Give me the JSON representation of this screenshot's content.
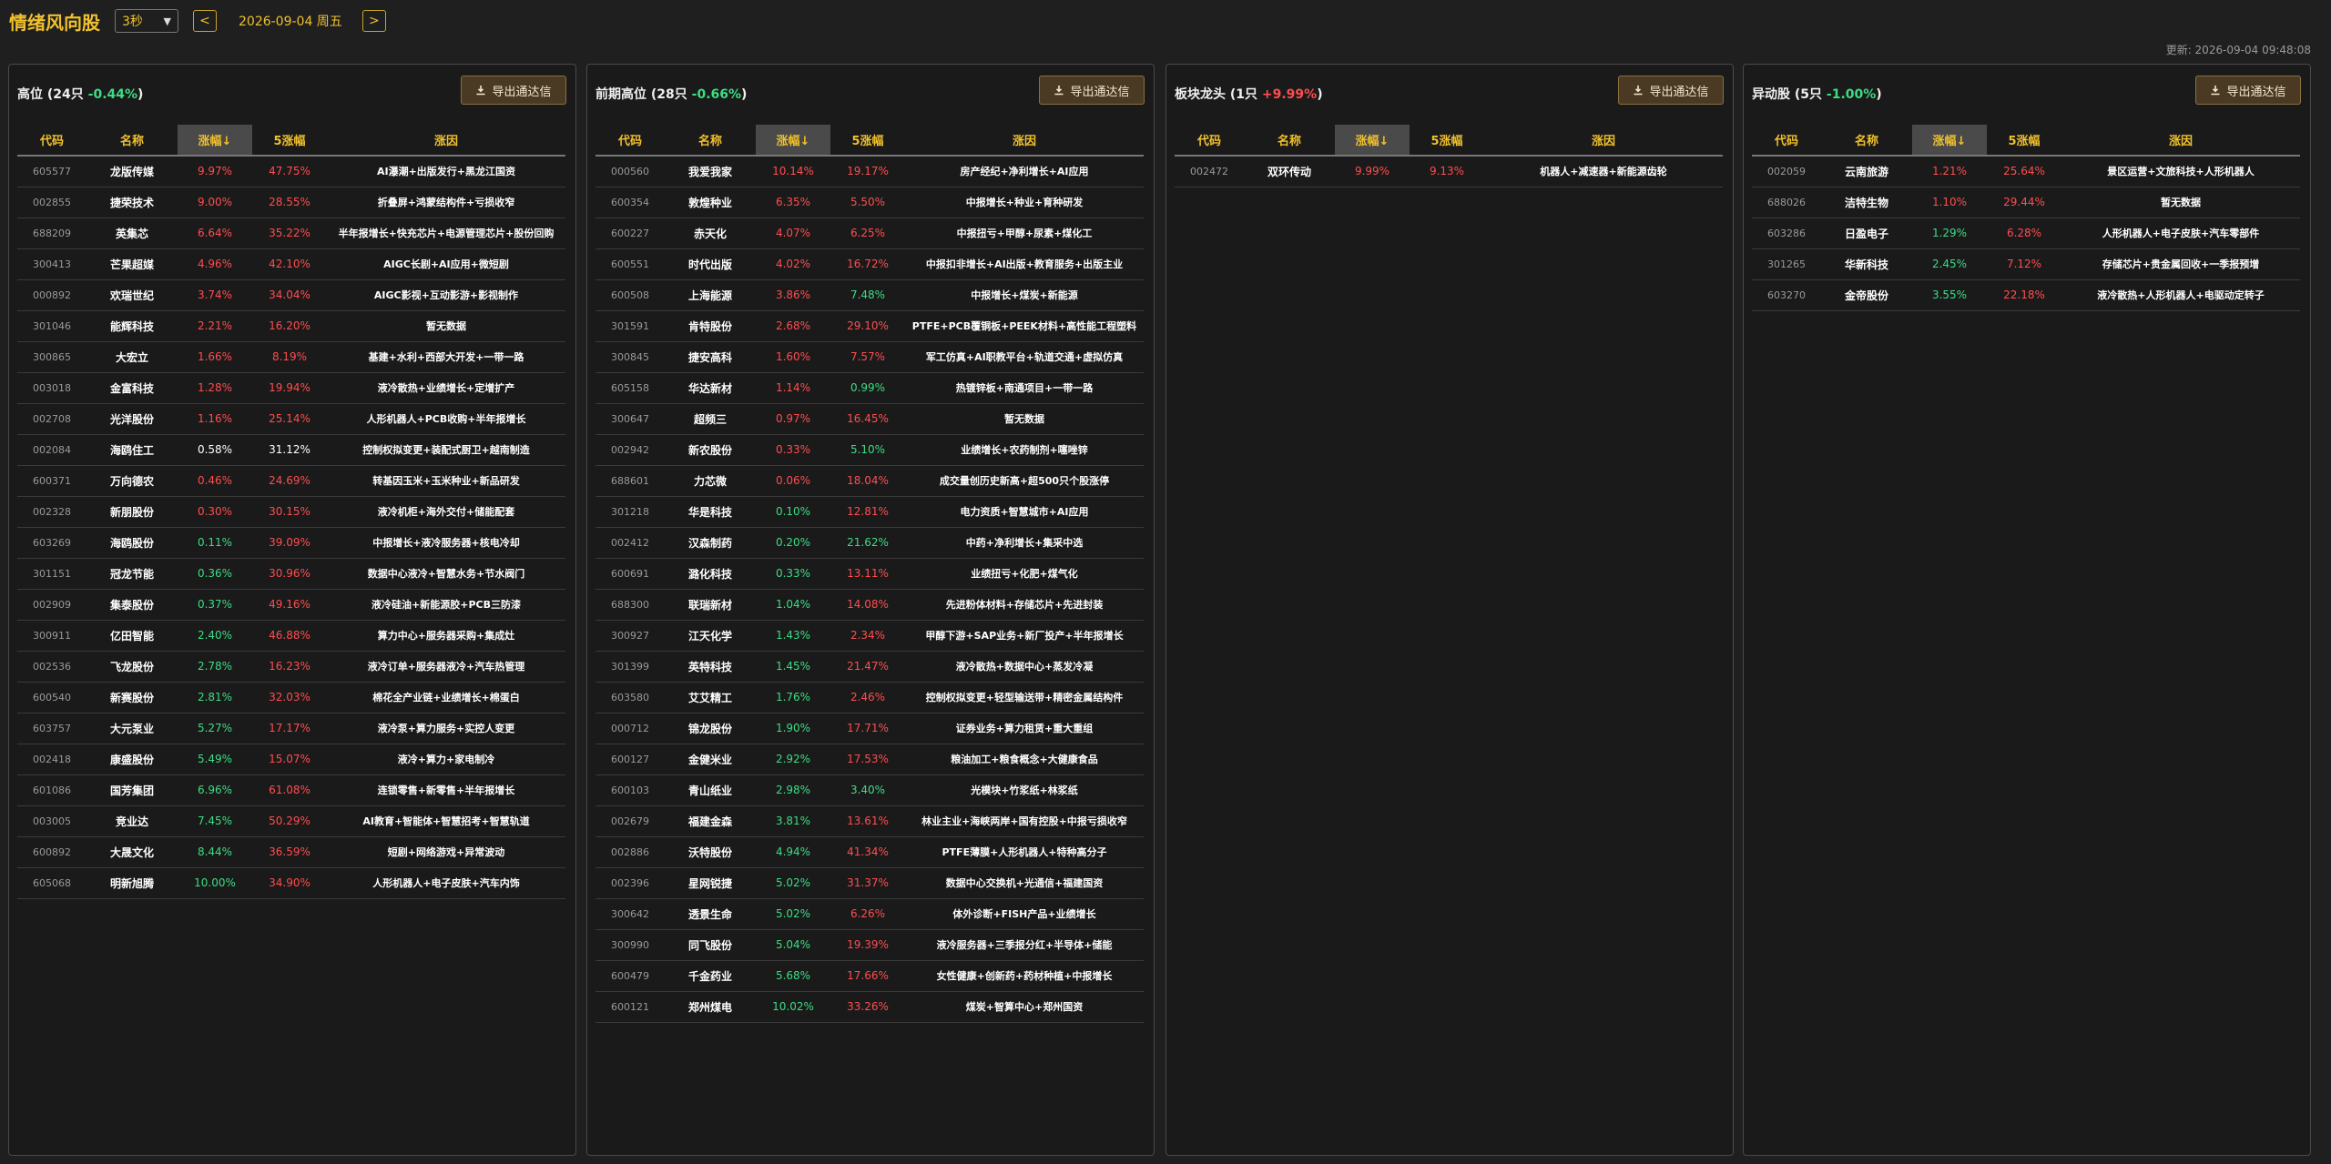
{
  "header": {
    "title": "情绪风向股",
    "refresh": "3秒",
    "prev": "<",
    "date": "2026-09-04 周五",
    "next": ">",
    "update": "更新: 2026-09-04 09:48:08"
  },
  "export_label": "导出通达信",
  "columns": [
    "代码",
    "名称",
    "涨幅↓",
    "5涨幅",
    "涨因"
  ],
  "colors": {
    "up": "#ff4d4f",
    "down": "#3ddc84",
    "accent": "#f0c02c"
  },
  "panels": [
    {
      "title": "高位 (24只",
      "change": "-0.44%",
      "change_color": "green",
      "rows": [
        [
          "605577",
          "龙版传媒",
          "9.97%",
          "47.75%",
          "AI瀑潮+出版发行+黑龙江国资",
          "red",
          "red"
        ],
        [
          "002855",
          "捷荣技术",
          "9.00%",
          "28.55%",
          "折叠屏+鸿蒙结构件+亏损收窄",
          "red",
          "red"
        ],
        [
          "688209",
          "英集芯",
          "6.64%",
          "35.22%",
          "半年报增长+快充芯片+电源管理芯片+股份回购",
          "red",
          "red"
        ],
        [
          "300413",
          "芒果超媒",
          "4.96%",
          "42.10%",
          "AIGC长剧+AI应用+微短剧",
          "red",
          "red"
        ],
        [
          "000892",
          "欢瑞世纪",
          "3.74%",
          "34.04%",
          "AIGC影视+互动影游+影视制作",
          "red",
          "red"
        ],
        [
          "301046",
          "能辉科技",
          "2.21%",
          "16.20%",
          "暂无数据",
          "red",
          "red"
        ],
        [
          "300865",
          "大宏立",
          "1.66%",
          "8.19%",
          "基建+水利+西部大开发+一带一路",
          "red",
          "red"
        ],
        [
          "003018",
          "金富科技",
          "1.28%",
          "19.94%",
          "液冷散热+业绩增长+定增扩产",
          "red",
          "red"
        ],
        [
          "002708",
          "光洋股份",
          "1.16%",
          "25.14%",
          "人形机器人+PCB收购+半年报增长",
          "red",
          "red"
        ],
        [
          "002084",
          "海鸥住工",
          "0.58%",
          "31.12%",
          "控制权拟变更+装配式厨卫+越南制造",
          "white",
          "white"
        ],
        [
          "600371",
          "万向德农",
          "0.46%",
          "24.69%",
          "转基因玉米+玉米种业+新品研发",
          "red",
          "red"
        ],
        [
          "002328",
          "新朋股份",
          "0.30%",
          "30.15%",
          "液冷机柜+海外交付+储能配套",
          "red",
          "red"
        ],
        [
          "603269",
          "海鸥股份",
          "0.11%",
          "39.09%",
          "中报增长+液冷服务器+核电冷却",
          "green",
          "red"
        ],
        [
          "301151",
          "冠龙节能",
          "0.36%",
          "30.96%",
          "数据中心液冷+智慧水务+节水阀门",
          "green",
          "red"
        ],
        [
          "002909",
          "集泰股份",
          "0.37%",
          "49.16%",
          "液冷硅油+新能源胶+PCB三防漆",
          "green",
          "red"
        ],
        [
          "300911",
          "亿田智能",
          "2.40%",
          "46.88%",
          "算力中心+服务器采购+集成灶",
          "green",
          "red"
        ],
        [
          "002536",
          "飞龙股份",
          "2.78%",
          "16.23%",
          "液冷订单+服务器液冷+汽车热管理",
          "green",
          "red"
        ],
        [
          "600540",
          "新赛股份",
          "2.81%",
          "32.03%",
          "棉花全产业链+业绩增长+棉蛋白",
          "green",
          "red"
        ],
        [
          "603757",
          "大元泵业",
          "5.27%",
          "17.17%",
          "液冷泵+算力服务+实控人变更",
          "green",
          "red"
        ],
        [
          "002418",
          "康盛股份",
          "5.49%",
          "15.07%",
          "液冷+算力+家电制冷",
          "green",
          "red"
        ],
        [
          "601086",
          "国芳集团",
          "6.96%",
          "61.08%",
          "连锁零售+新零售+半年报增长",
          "green",
          "red"
        ],
        [
          "003005",
          "竞业达",
          "7.45%",
          "50.29%",
          "AI教育+智能体+智慧招考+智慧轨道",
          "green",
          "red"
        ],
        [
          "600892",
          "大晟文化",
          "8.44%",
          "36.59%",
          "短剧+网络游戏+异常波动",
          "green",
          "red"
        ],
        [
          "605068",
          "明新旭腾",
          "10.00%",
          "34.90%",
          "人形机器人+电子皮肤+汽车内饰",
          "green",
          "red"
        ]
      ]
    },
    {
      "title": "前期高位 (28只",
      "change": "-0.66%",
      "change_color": "green",
      "rows": [
        [
          "000560",
          "我爱我家",
          "10.14%",
          "19.17%",
          "房产经纪+净利增长+AI应用",
          "red",
          "red"
        ],
        [
          "600354",
          "敦煌种业",
          "6.35%",
          "5.50%",
          "中报增长+种业+育种研发",
          "red",
          "red"
        ],
        [
          "600227",
          "赤天化",
          "4.07%",
          "6.25%",
          "中报扭亏+甲醇+尿素+煤化工",
          "red",
          "red"
        ],
        [
          "600551",
          "时代出版",
          "4.02%",
          "16.72%",
          "中报扣非增长+AI出版+教育服务+出版主业",
          "red",
          "red"
        ],
        [
          "600508",
          "上海能源",
          "3.86%",
          "7.48%",
          "中报增长+煤炭+新能源",
          "red",
          "green"
        ],
        [
          "301591",
          "肯特股份",
          "2.68%",
          "29.10%",
          "PTFE+PCB覆铜板+PEEK材料+高性能工程塑料",
          "red",
          "red"
        ],
        [
          "300845",
          "捷安高科",
          "1.60%",
          "7.57%",
          "军工仿真+AI职教平台+轨道交通+虚拟仿真",
          "red",
          "red"
        ],
        [
          "605158",
          "华达新材",
          "1.14%",
          "0.99%",
          "热镀锌板+南通项目+一带一路",
          "red",
          "green"
        ],
        [
          "300647",
          "超频三",
          "0.97%",
          "16.45%",
          "暂无数据",
          "red",
          "red"
        ],
        [
          "002942",
          "新农股份",
          "0.33%",
          "5.10%",
          "业绩增长+农药制剂+噻唑锌",
          "red",
          "green"
        ],
        [
          "688601",
          "力芯微",
          "0.06%",
          "18.04%",
          "成交量创历史新高+超500只个股涨停",
          "red",
          "red"
        ],
        [
          "301218",
          "华是科技",
          "0.10%",
          "12.81%",
          "电力资质+智慧城市+AI应用",
          "green",
          "red"
        ],
        [
          "002412",
          "汉森制药",
          "0.20%",
          "21.62%",
          "中药+净利增长+集采中选",
          "green",
          "green"
        ],
        [
          "600691",
          "潞化科技",
          "0.33%",
          "13.11%",
          "业绩扭亏+化肥+煤气化",
          "green",
          "red"
        ],
        [
          "688300",
          "联瑞新材",
          "1.04%",
          "14.08%",
          "先进粉体材料+存储芯片+先进封装",
          "green",
          "red"
        ],
        [
          "300927",
          "江天化学",
          "1.43%",
          "2.34%",
          "甲醇下游+SAP业务+新厂投产+半年报增长",
          "green",
          "red"
        ],
        [
          "301399",
          "英特科技",
          "1.45%",
          "21.47%",
          "液冷散热+数据中心+蒸发冷凝",
          "green",
          "red"
        ],
        [
          "603580",
          "艾艾精工",
          "1.76%",
          "2.46%",
          "控制权拟变更+轻型输送带+精密金属结构件",
          "green",
          "red"
        ],
        [
          "000712",
          "锦龙股份",
          "1.90%",
          "17.71%",
          "证券业务+算力租赁+重大重组",
          "green",
          "red"
        ],
        [
          "600127",
          "金健米业",
          "2.92%",
          "17.53%",
          "粮油加工+粮食概念+大健康食品",
          "green",
          "red"
        ],
        [
          "600103",
          "青山纸业",
          "2.98%",
          "3.40%",
          "光模块+竹浆纸+林浆纸",
          "green",
          "green"
        ],
        [
          "002679",
          "福建金森",
          "3.81%",
          "13.61%",
          "林业主业+海峡两岸+国有控股+中报亏损收窄",
          "green",
          "red"
        ],
        [
          "002886",
          "沃特股份",
          "4.94%",
          "41.34%",
          "PTFE薄膜+人形机器人+特种高分子",
          "green",
          "red"
        ],
        [
          "002396",
          "星网锐捷",
          "5.02%",
          "31.37%",
          "数据中心交换机+光通信+福建国资",
          "green",
          "red"
        ],
        [
          "300642",
          "透景生命",
          "5.02%",
          "6.26%",
          "体外诊断+FISH产品+业绩增长",
          "green",
          "red"
        ],
        [
          "300990",
          "同飞股份",
          "5.04%",
          "19.39%",
          "液冷服务器+三季报分红+半导体+储能",
          "green",
          "red"
        ],
        [
          "600479",
          "千金药业",
          "5.68%",
          "17.66%",
          "女性健康+创新药+药材种植+中报增长",
          "green",
          "red"
        ],
        [
          "600121",
          "郑州煤电",
          "10.02%",
          "33.26%",
          "煤炭+智算中心+郑州国资",
          "green",
          "red"
        ]
      ]
    },
    {
      "title": "板块龙头 (1只",
      "change": "+9.99%",
      "change_color": "red",
      "rows": [
        [
          "002472",
          "双环传动",
          "9.99%",
          "9.13%",
          "机器人+减速器+新能源齿轮",
          "red",
          "red"
        ]
      ]
    },
    {
      "title": "异动股 (5只",
      "change": "-1.00%",
      "change_color": "green",
      "rows": [
        [
          "002059",
          "云南旅游",
          "1.21%",
          "25.64%",
          "景区运营+文旅科技+人形机器人",
          "red",
          "red"
        ],
        [
          "688026",
          "洁特生物",
          "1.10%",
          "29.44%",
          "暂无数据",
          "red",
          "red"
        ],
        [
          "603286",
          "日盈电子",
          "1.29%",
          "6.28%",
          "人形机器人+电子皮肤+汽车零部件",
          "green",
          "red"
        ],
        [
          "301265",
          "华新科技",
          "2.45%",
          "7.12%",
          "存储芯片+贵金属回收+一季报预增",
          "green",
          "red"
        ],
        [
          "603270",
          "金帝股份",
          "3.55%",
          "22.18%",
          "液冷散热+人形机器人+电驱动定转子",
          "green",
          "red"
        ]
      ]
    }
  ]
}
